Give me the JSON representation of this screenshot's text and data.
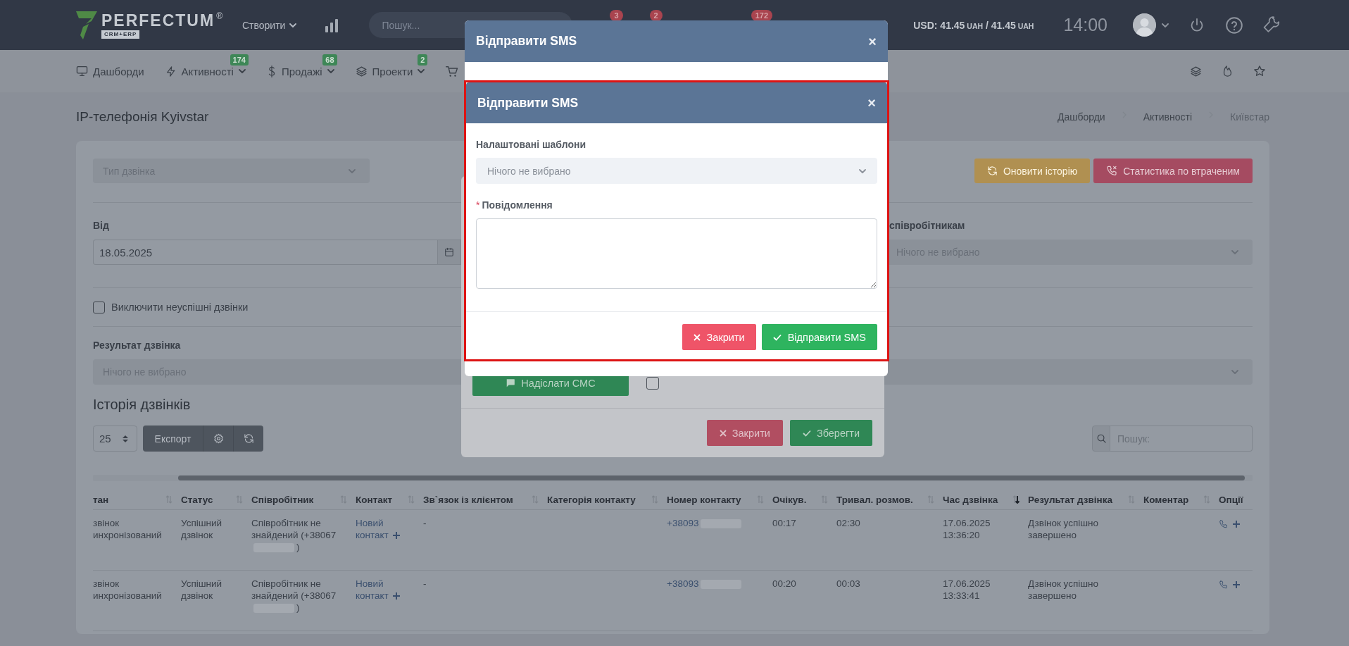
{
  "topbar": {
    "logo": {
      "name": "PERFECTUM",
      "mark": "®",
      "tagline": "CRM+ERP"
    },
    "create_menu": "Створити",
    "search": {
      "placeholder": "Пошук..."
    },
    "badges": [
      {
        "count": "3"
      },
      {
        "count": "2"
      },
      {
        "count": "172"
      }
    ],
    "currency": [
      {
        "text": "USD: 41.45",
        "kind": "value"
      },
      {
        "text": "UAH",
        "kind": "unit"
      },
      {
        "text": "/ 41.45",
        "kind": "value"
      },
      {
        "text": "UAH",
        "kind": "unit"
      }
    ],
    "time": "14:00"
  },
  "nav": {
    "items": [
      {
        "label": "Дашборди",
        "dropdown": false
      },
      {
        "label": "Активності",
        "badge": "174",
        "dropdown": true
      },
      {
        "label": "Продажі",
        "badge": "68",
        "dropdown": true
      },
      {
        "label": "Проекти",
        "badge": "2",
        "dropdown": true
      }
    ]
  },
  "page": {
    "title": "IP-телефонія Kyivstar",
    "breadcrumb": [
      {
        "label": "Дашборди",
        "current": false
      },
      {
        "label": "Активності",
        "current": false
      },
      {
        "label": "Київстар",
        "current": true
      }
    ]
  },
  "filters": {
    "call_type": {
      "placeholder": "Тип дзвінка"
    },
    "buttons": [
      {
        "label": "Оновити історію",
        "kind": "warning"
      },
      {
        "label": "Статистика по втраченим",
        "kind": "danger"
      }
    ],
    "from": {
      "label": "Від",
      "value": "18.05.2025"
    },
    "employees": {
      "label": "співробітникам",
      "placeholder": "Нічого не вибрано"
    },
    "exclude_failed": {
      "label": "Виключити неуспішні дзвінки",
      "checked": false
    },
    "result": {
      "label": "Результат дзвінка",
      "placeholder": "Нічого не вибрано"
    }
  },
  "history": {
    "title": "Історія дзвінків",
    "page_size": "25",
    "export": "Експорт",
    "search": {
      "placeholder": "Пошук:"
    }
  },
  "table": {
    "columns": [
      {
        "label": "тан",
        "sortable": true,
        "sorted_desc": false
      },
      {
        "label": "Статус",
        "sortable": true,
        "sorted_desc": false
      },
      {
        "label": "Співробітник",
        "sortable": true,
        "sorted_desc": false
      },
      {
        "label": "Контакт",
        "sortable": true,
        "sorted_desc": false
      },
      {
        "label": "Зв`язок із клієнтом",
        "sortable": true,
        "sorted_desc": false
      },
      {
        "label": "Категорія контакту",
        "sortable": true,
        "sorted_desc": false
      },
      {
        "label": "Номер контакту",
        "sortable": true,
        "sorted_desc": false
      },
      {
        "label": "Очікув.",
        "sortable": true,
        "sorted_desc": false
      },
      {
        "label": "Тривал. розмов.",
        "sortable": true,
        "sorted_desc": false
      },
      {
        "label": "Час дзвінка",
        "sortable": true,
        "sorted_desc": true
      },
      {
        "label": "Результат дзвінка",
        "sortable": true,
        "sorted_desc": false
      },
      {
        "label": "Коментар",
        "sortable": true,
        "sorted_desc": false
      },
      {
        "label": "Опції",
        "sortable": false
      }
    ],
    "rows": [
      {
        "state": "звінок инхронізований",
        "status": "Успішний дзвінок",
        "employee": "Співробітник не знайдений (+38067",
        "employee_end": ")",
        "contact": "Новий контакт",
        "relation": "-",
        "phone": "+38093",
        "wait": "00:17",
        "duration": "02:30",
        "time": "17.06.2025 13:36:20",
        "result": "Дзвінок успішно завершено"
      },
      {
        "state": "звінок инхронізований",
        "status": "Успішний дзвінок",
        "employee": "Співробітник не знайдений (+38067",
        "employee_end": ")",
        "contact": "Новий контакт",
        "relation": "-",
        "phone": "+38093",
        "wait": "00:20",
        "duration": "00:03",
        "time": "17.06.2025 13:33:41",
        "result": "Дзвінок успішно завершено"
      }
    ]
  },
  "back_modal": {
    "send_sms_button": "Надіслати СМС",
    "schedule_checkbox": {
      "checked": false
    },
    "buttons": [
      {
        "label": "Закрити",
        "kind": "close"
      },
      {
        "label": "Зберегти",
        "kind": "save"
      }
    ]
  },
  "sms_modal": {
    "title": "Відправити SMS",
    "close": "×",
    "inner": {
      "highlighted": true,
      "title": "Відправити SMS",
      "close": "×",
      "template": {
        "label": "Налаштовані шаблони",
        "placeholder": "Нічого не вибрано"
      },
      "message": {
        "label": "Повідомлення",
        "required_mark": "*"
      },
      "buttons": [
        {
          "label": "Закрити",
          "kind": "close"
        },
        {
          "label": "Відправити SMS",
          "kind": "send"
        }
      ]
    }
  }
}
